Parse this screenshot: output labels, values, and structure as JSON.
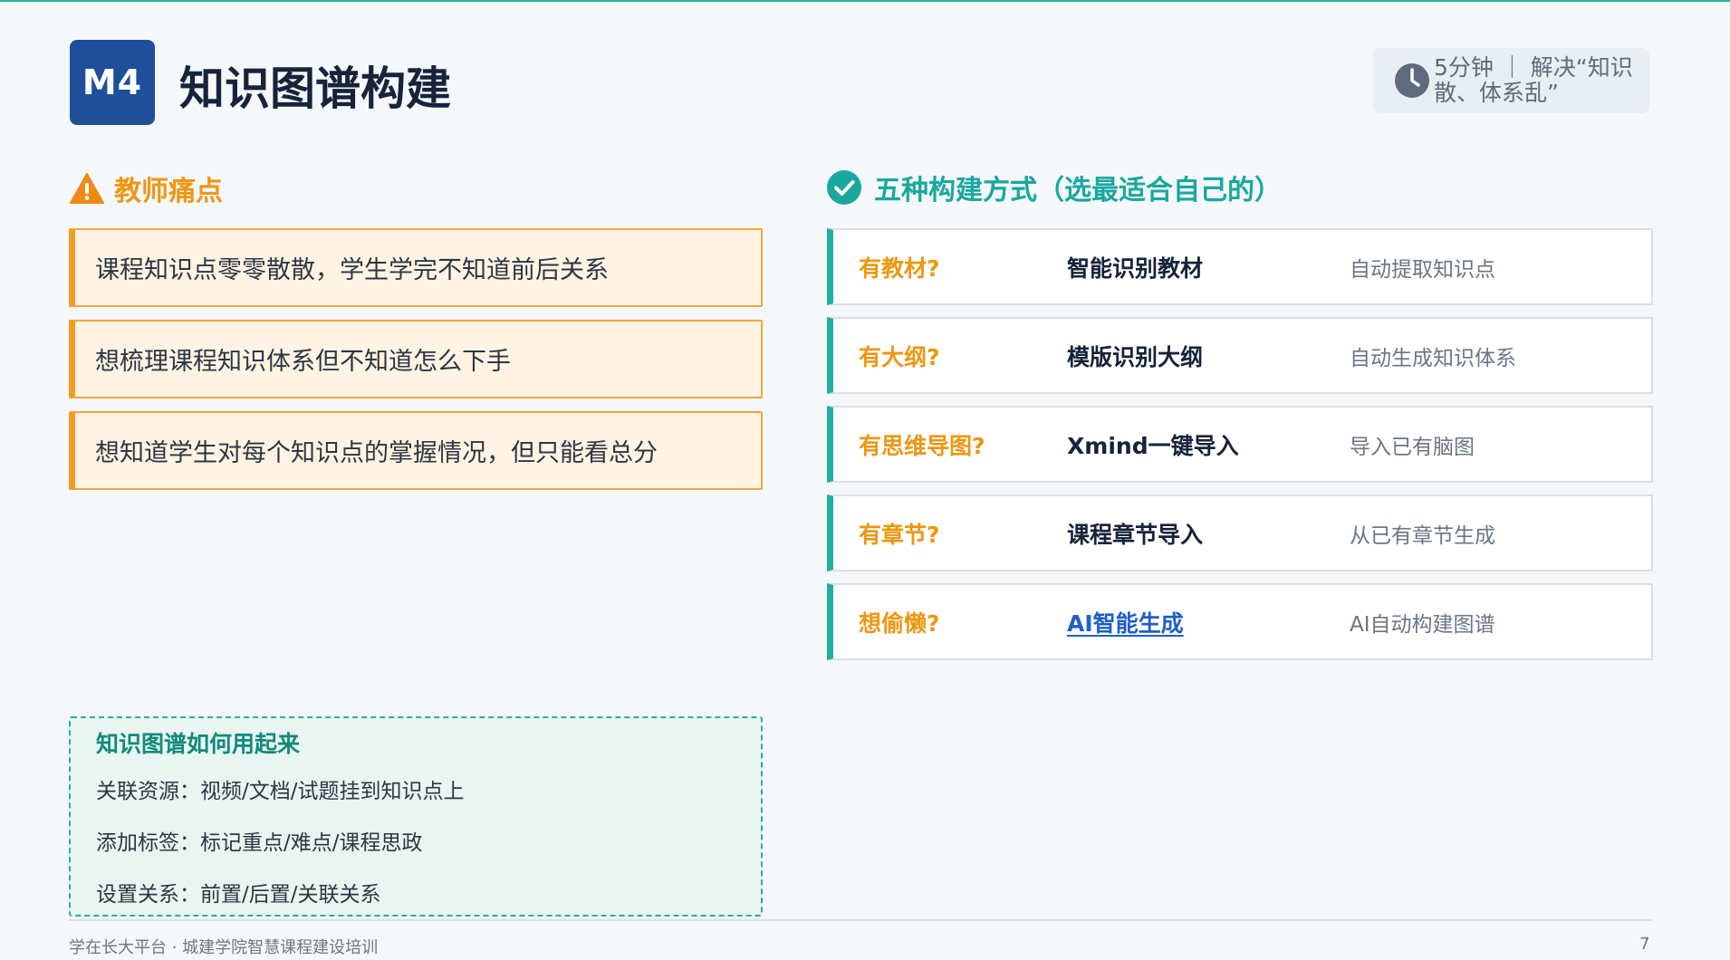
{
  "header": {
    "badge": "M4",
    "title": "知识图谱构建",
    "time_line1": "5分钟 ｜ 解决“知识",
    "time_line2": "散、体系乱”"
  },
  "pain": {
    "heading": "教师痛点",
    "items": [
      "课程知识点零零散散，学生学完不知道前后关系",
      "想梳理课程知识体系但不知道怎么下手",
      "想知道学生对每个知识点的掌握情况，但只能看总分"
    ]
  },
  "ways": {
    "heading": "五种构建方式（选最适合自己的）",
    "rows": [
      {
        "question": "有教材?",
        "method": "智能识别教材",
        "result": "自动提取知识点"
      },
      {
        "question": "有大纲?",
        "method": "模版识别大纲",
        "result": "自动生成知识体系"
      },
      {
        "question": "有思维导图?",
        "method": "Xmind一键导入",
        "result": "导入已有脑图"
      },
      {
        "question": "有章节?",
        "method": "课程章节导入",
        "result": "从已有章节生成"
      },
      {
        "question": "想偷懒?",
        "method": "AI智能生成",
        "result": "AI自动构建图谱"
      }
    ]
  },
  "usage": {
    "title": "知识图谱如何用起来",
    "items": [
      "关联资源：视频/文档/试题挂到知识点上",
      "添加标签：标记重点/难点/课程思政",
      "设置关系：前置/后置/关联关系"
    ]
  },
  "footer": {
    "left": "学在长大平台 · 城建学院智慧课程建设培训",
    "page_number": "7"
  },
  "colors": {
    "badge": "#1f4f99",
    "orange": "#ee9712",
    "teal": "#1aa89e",
    "link": "#1e5fc8"
  },
  "icons": [
    "clock-icon",
    "warning-icon",
    "check-circle-icon"
  ]
}
